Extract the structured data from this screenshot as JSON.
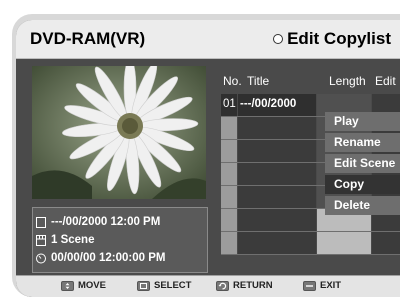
{
  "header": {
    "title": "DVD-RAM(VR)",
    "menu_title": "Edit Copylist"
  },
  "info": {
    "date": "---/00/2000 12:00 PM",
    "scenes": "1 Scene",
    "time": "00/00/00 12:00:00 PM"
  },
  "table": {
    "col_no": "No.",
    "col_title": "Title",
    "col_length": "Length",
    "col_edit": "Edit",
    "selected_no": "01",
    "selected_title": "---/00/2000"
  },
  "popup": {
    "items": [
      "Play",
      "Rename",
      "Edit Scene",
      "Copy",
      "Delete"
    ],
    "active_index": 3
  },
  "footer": {
    "move": "MOVE",
    "select": "SELECT",
    "return": "RETURN",
    "exit": "EXIT"
  },
  "colors": {
    "panel": "#4a4a4a",
    "header": "#ececec",
    "popup_item": "#6e6e6e",
    "popup_active": "#333333"
  },
  "icons": [
    "circle-icon",
    "calendar-icon",
    "film-icon",
    "clock-icon",
    "move-icon",
    "select-icon",
    "return-icon",
    "exit-icon"
  ]
}
